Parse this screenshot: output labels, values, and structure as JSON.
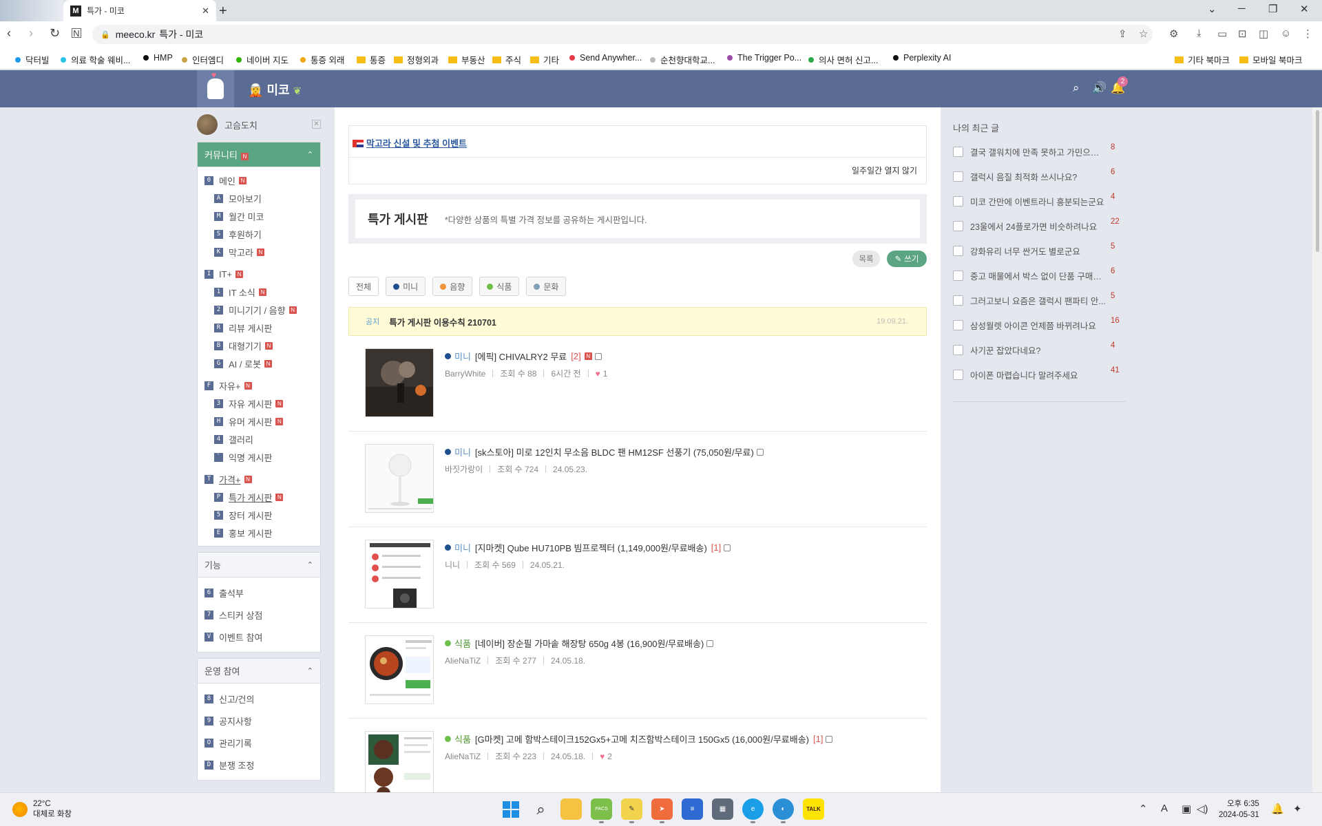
{
  "browser": {
    "tab_title": "특가 - 미코",
    "tab_favicon": "M",
    "url_host": "meeco.kr",
    "url_page_title": "특가 - 미코",
    "bookmarks_left": [
      {
        "label": "닥터빌",
        "color": "#1e9be8",
        "type": "dot"
      },
      {
        "label": "의료 학술 웨비...",
        "color": "#27c4e3",
        "type": "dot"
      },
      {
        "label": "HMP",
        "color": "#111111",
        "type": "dot"
      },
      {
        "label": "인터엠디",
        "color": "#c8a34a",
        "type": "dot"
      },
      {
        "label": "네이버 지도",
        "color": "#2db400",
        "type": "dot"
      },
      {
        "label": "통증 외래",
        "color": "#f2a516",
        "type": "dot"
      },
      {
        "label": "통증",
        "color": "#f6bd16",
        "type": "folder"
      },
      {
        "label": "정형외과",
        "color": "#f6bd16",
        "type": "folder"
      },
      {
        "label": "부동산",
        "color": "#f6bd16",
        "type": "folder"
      },
      {
        "label": "주식",
        "color": "#f6bd16",
        "type": "folder"
      },
      {
        "label": "기타",
        "color": "#f6bd16",
        "type": "folder"
      },
      {
        "label": "Send Anywher...",
        "color": "#e8364b",
        "type": "dot"
      },
      {
        "label": "순천향대학교...",
        "color": "#bbbbbb",
        "type": "dot"
      },
      {
        "label": "The Trigger Po...",
        "color": "#9b4fa8",
        "type": "dot"
      },
      {
        "label": "의사 면허 신고...",
        "color": "#2aa84a",
        "type": "dot"
      },
      {
        "label": "Perplexity AI",
        "color": "#111111",
        "type": "dot"
      }
    ],
    "bookmarks_right": [
      {
        "label": "기타 북마크"
      },
      {
        "label": "모바일 북마크"
      }
    ]
  },
  "site": {
    "name": "미코",
    "notification_count": "2"
  },
  "user": {
    "name": "고슴도치"
  },
  "sidebar": {
    "community": {
      "title": "커뮤니티",
      "items": [
        {
          "key": "0",
          "label": "메인",
          "new": true,
          "level": 0
        },
        {
          "key": "A",
          "label": "모아보기",
          "new": false,
          "level": 1
        },
        {
          "key": "M",
          "label": "월간 미코",
          "new": false,
          "level": 1
        },
        {
          "key": "S",
          "label": "후원하기",
          "new": false,
          "level": 1
        },
        {
          "key": "K",
          "label": "막고라",
          "new": true,
          "level": 1
        },
        {
          "key": "I",
          "label": "IT+",
          "new": true,
          "level": 0
        },
        {
          "key": "1",
          "label": "IT 소식",
          "new": true,
          "level": 1
        },
        {
          "key": "2",
          "label": "미니기기 / 음향",
          "new": true,
          "level": 1
        },
        {
          "key": "R",
          "label": "리뷰 게시판",
          "new": false,
          "level": 1
        },
        {
          "key": "B",
          "label": "대형기기",
          "new": true,
          "level": 1
        },
        {
          "key": "G",
          "label": "AI / 로봇",
          "new": true,
          "level": 1
        },
        {
          "key": "F",
          "label": "자유+",
          "new": true,
          "level": 0
        },
        {
          "key": "3",
          "label": "자유 게시판",
          "new": true,
          "level": 1
        },
        {
          "key": "H",
          "label": "유머 게시판",
          "new": true,
          "level": 1
        },
        {
          "key": "4",
          "label": "갤러리",
          "new": false,
          "level": 1
        },
        {
          "key": "`",
          "label": "익명 게시판",
          "new": false,
          "level": 1
        },
        {
          "key": "T",
          "label": "가격+",
          "new": true,
          "level": 0,
          "underline": true
        },
        {
          "key": "P",
          "label": "특가 게시판",
          "new": true,
          "level": 1,
          "underline": true
        },
        {
          "key": "5",
          "label": "장터 게시판",
          "new": false,
          "level": 1
        },
        {
          "key": "E",
          "label": "홍보 게시판",
          "new": false,
          "level": 1
        }
      ]
    },
    "features": {
      "title": "기능",
      "items": [
        {
          "key": "6",
          "label": "출석부"
        },
        {
          "key": "7",
          "label": "스티커 상점"
        },
        {
          "key": "V",
          "label": "이벤트 참여"
        }
      ]
    },
    "operations": {
      "title": "운영 참여",
      "items": [
        {
          "key": "8",
          "label": "신고/건의"
        },
        {
          "key": "9",
          "label": "공지사항"
        },
        {
          "key": "O",
          "label": "관리기록"
        },
        {
          "key": "D",
          "label": "분쟁 조정"
        }
      ]
    }
  },
  "main": {
    "event_link": "막고라 신설 및 추첨 이벤트",
    "hide_week": "일주일간 열지 않기",
    "board_title": "특가 게시판",
    "board_desc": "*다양한 상품의 특별 가격 정보를 공유하는 게시판입니다.",
    "btn_list": "목록",
    "btn_write": "쓰기",
    "filters": [
      {
        "label": "전체",
        "color": ""
      },
      {
        "label": "미니",
        "color": "#1f4f8f"
      },
      {
        "label": "음향",
        "color": "#f0923a"
      },
      {
        "label": "식품",
        "color": "#6cc04a"
      },
      {
        "label": "문화",
        "color": "#7ea0b8"
      }
    ],
    "notice": {
      "tag": "공지",
      "title": "특가 게시판 이용수칙 210701",
      "date": "19.09.21."
    },
    "posts": [
      {
        "category": "미니",
        "cat_color": "#1f4f8f",
        "title": "[에픽] CHIVALRY2 무료",
        "comments": "[2]",
        "new": true,
        "author": "BarryWhite",
        "views": "조회 수 88",
        "date": "6시간 전",
        "likes": "1",
        "thumb": "game"
      },
      {
        "category": "미니",
        "cat_color": "#1f4f8f",
        "title": "[sk스토아] 미로 12인치 무소음 BLDC 팬 HM12SF 선풍기 (75,050원/무료)",
        "comments": "",
        "new": false,
        "author": "바짓가랑이",
        "views": "조회 수 724",
        "date": "24.05.23.",
        "likes": "",
        "thumb": "fan"
      },
      {
        "category": "미니",
        "cat_color": "#1f4f8f",
        "title": "[지마켓] Qube HU710PB 빔프로젝터 (1,149,000원/무료배송)",
        "comments": "[1]",
        "new": false,
        "author": "니니",
        "views": "조회 수 569",
        "date": "24.05.21.",
        "likes": "",
        "thumb": "doc"
      },
      {
        "category": "식품",
        "cat_color": "#6cc04a",
        "title": "[네이버] 장순필 가마솥 해장탕 650g 4봉 (16,900원/무료배송)",
        "comments": "",
        "new": false,
        "author": "AlieNaTiZ",
        "views": "조회 수 277",
        "date": "24.05.18.",
        "likes": "",
        "thumb": "soup"
      },
      {
        "category": "식품",
        "cat_color": "#6cc04a",
        "title": "[G마켓] 고메 함박스테이크152Gx5+고메 치즈함박스테이크 150Gx5 (16,000원/무료배송)",
        "comments": "[1]",
        "new": false,
        "author": "AlieNaTiZ",
        "views": "조회 수 223",
        "date": "24.05.18.",
        "likes": "2",
        "thumb": "steak"
      }
    ]
  },
  "right": {
    "title": "나의 최근 글",
    "items": [
      {
        "text": "결국 갤워치에 만족 못하고 가민으로 ...",
        "count": "8"
      },
      {
        "text": "갤럭시 음질 최적화 쓰시나요?",
        "count": "6"
      },
      {
        "text": "미코 간만에 이벤트라니 흥분되는군요",
        "count": "4"
      },
      {
        "text": "23울에서 24플로가면 비슷하려나요",
        "count": "22"
      },
      {
        "text": "강화유리 너무 싼거도 별로군요",
        "count": "5"
      },
      {
        "text": "중고 매물에서 박스 없이 단품 구매해...",
        "count": "6"
      },
      {
        "text": "그러고보니 요즘은 갤럭시 팬파티 안...",
        "count": "5"
      },
      {
        "text": "삼성월렛 아이콘 언제쯤 바뀌려나요",
        "count": "16"
      },
      {
        "text": "사기꾼 잡았다네요?",
        "count": "4"
      },
      {
        "text": "아이폰 마렵습니다 말려주세요",
        "count": "41"
      }
    ]
  },
  "taskbar": {
    "temp": "22°C",
    "weather": "대체로 화창",
    "time": "오후 6:35",
    "date": "2024-05-31"
  }
}
